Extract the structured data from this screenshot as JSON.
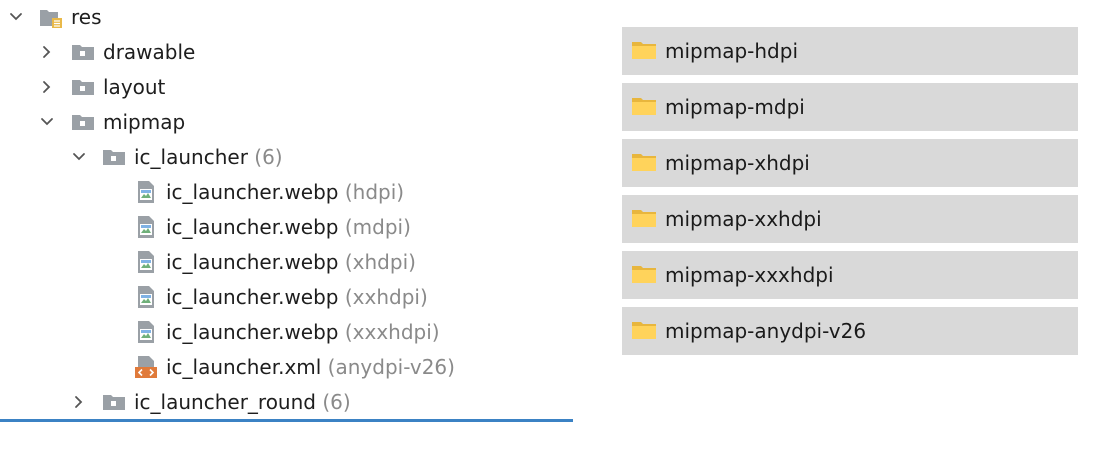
{
  "tree": {
    "root": {
      "label": "res"
    },
    "items": [
      {
        "label": "drawable"
      },
      {
        "label": "layout"
      },
      {
        "label": "mipmap"
      },
      {
        "label": "ic_launcher",
        "hint": "(6)"
      },
      {
        "label": "ic_launcher.webp",
        "hint": "(hdpi)"
      },
      {
        "label": "ic_launcher.webp",
        "hint": "(mdpi)"
      },
      {
        "label": "ic_launcher.webp",
        "hint": "(xhdpi)"
      },
      {
        "label": "ic_launcher.webp",
        "hint": "(xxhdpi)"
      },
      {
        "label": "ic_launcher.webp",
        "hint": "(xxxhdpi)"
      },
      {
        "label": "ic_launcher.xml",
        "hint": "(anydpi-v26)"
      },
      {
        "label": "ic_launcher_round",
        "hint": "(6)"
      }
    ]
  },
  "folders": [
    {
      "label": "mipmap-hdpi"
    },
    {
      "label": "mipmap-mdpi"
    },
    {
      "label": "mipmap-xhdpi"
    },
    {
      "label": "mipmap-xxhdpi"
    },
    {
      "label": "mipmap-xxxhdpi"
    },
    {
      "label": "mipmap-anydpi-v26"
    }
  ],
  "colors": {
    "selection_line": "#3b82c4",
    "folder_row_bg": "#d9d9d9",
    "folder_icon": "#f5c542",
    "hint_text": "#8a8a8a",
    "xml_icon": "#e07a3a"
  },
  "icons": {
    "expand_open": "chevron-down-icon",
    "expand_closed": "chevron-right-icon",
    "res_folder": "resource-folder-icon",
    "folder": "folder-icon",
    "image_file": "image-file-icon",
    "xml_file": "xml-file-icon"
  }
}
